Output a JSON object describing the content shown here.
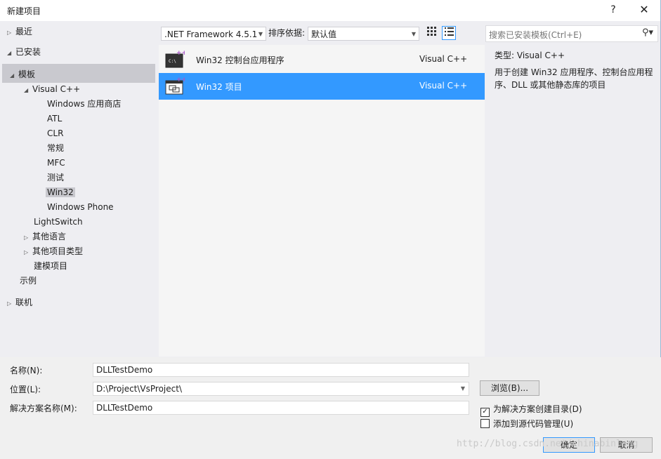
{
  "window": {
    "title": "新建项目",
    "help": "?",
    "close": "✕"
  },
  "tree": {
    "recent": "最近",
    "installed": "已安装",
    "templates": "模板",
    "visual_cpp": "Visual C++",
    "windows_store": "Windows 应用商店",
    "atl": "ATL",
    "clr": "CLR",
    "general": "常规",
    "mfc": "MFC",
    "test": "测试",
    "win32": "Win32",
    "windows_phone": "Windows Phone",
    "lightswitch": "LightSwitch",
    "other_languages": "其他语言",
    "other_project_types": "其他项目类型",
    "modeling_projects": "建模项目",
    "samples": "示例",
    "online": "联机"
  },
  "toolbar": {
    "framework": ".NET Framework 4.5.1",
    "sort_label": "排序依据:",
    "sort_value": "默认值"
  },
  "search": {
    "placeholder": "搜索已安装模板(Ctrl+E)"
  },
  "templates": [
    {
      "name": "Win32 控制台应用程序",
      "lang": "Visual C++",
      "selected": false,
      "icon": "console-app-icon"
    },
    {
      "name": "Win32 项目",
      "lang": "Visual C++",
      "selected": true,
      "icon": "win32-project-icon"
    }
  ],
  "details": {
    "type_label": "类型:",
    "type_value": "Visual C++",
    "description": "用于创建 Win32 应用程序、控制台应用程序、DLL 或其他静态库的项目"
  },
  "form": {
    "name_label": "名称(N):",
    "name_value": "DLLTestDemo",
    "location_label": "位置(L):",
    "location_value": "D:\\Project\\VsProject\\",
    "solution_label": "解决方案名称(M):",
    "solution_value": "DLLTestDemo",
    "browse": "浏览(B)...",
    "create_dir": "为解决方案创建目录(D)",
    "create_dir_checked": true,
    "source_control": "添加到源代码管理(U)",
    "source_control_checked": false,
    "ok": "确定",
    "cancel": "取消"
  },
  "watermark": "http://blog.csdn.net/chinabinlang",
  "colors": {
    "selection": "#3399ff",
    "tree_selected": "#c9c9cf",
    "background": "#eeeef2"
  }
}
